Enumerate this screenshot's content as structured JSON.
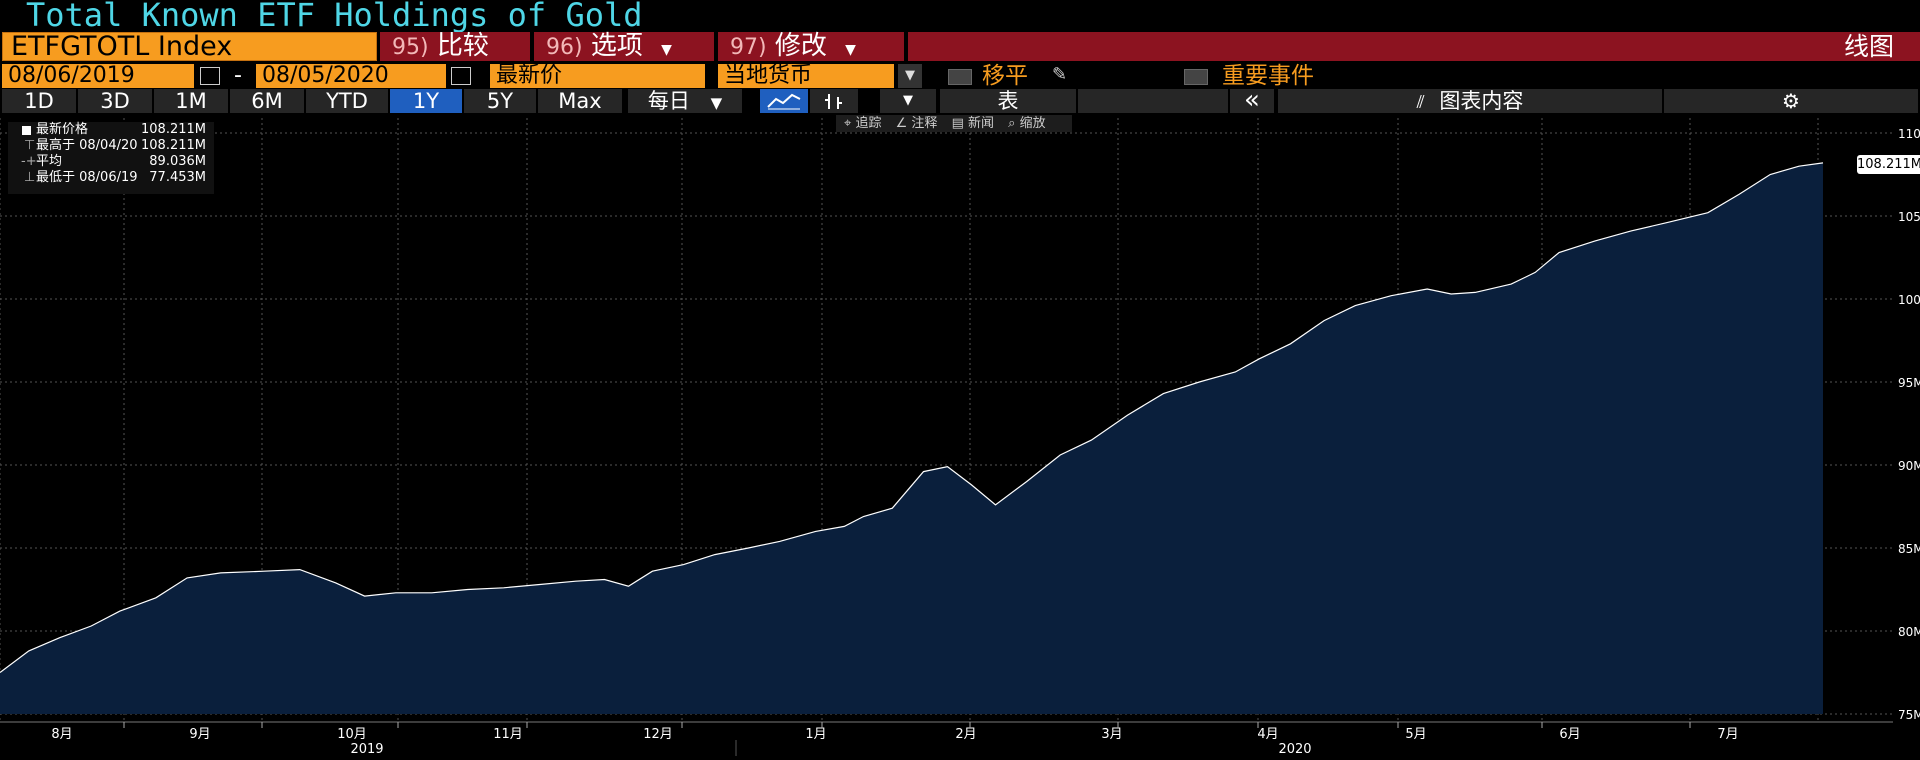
{
  "title": "Total Known ETF Holdings of Gold",
  "toolbar_row1": {
    "ticker": "ETFGTOTL Index",
    "compare": {
      "num": "95)",
      "label": "比较"
    },
    "options": {
      "num": "96)",
      "label": "选项"
    },
    "modify": {
      "num": "97)",
      "label": "修改"
    },
    "chart_type": "线图"
  },
  "toolbar_row2": {
    "start_date": "08/06/2019",
    "dash": "-",
    "end_date": "08/05/2020",
    "field": "最新价",
    "currency": "当地货币",
    "moving_avg": "移平",
    "events": "重要事件"
  },
  "toolbar_row3": {
    "ranges": [
      "1D",
      "3D",
      "1M",
      "6M",
      "YTD",
      "1Y",
      "5Y",
      "Max"
    ],
    "selected_range": "1Y",
    "frequency": "每日",
    "table": "表",
    "collapse": "«",
    "chart_content": "图表内容"
  },
  "chart_tools": {
    "track": "追踪",
    "annotate": "注释",
    "news": "新闻",
    "zoom": "缩放"
  },
  "legend": {
    "last_label": "最新价格",
    "last_value": "108.211M",
    "high_label": "最高于 08/04/20",
    "high_value": "108.211M",
    "avg_label": "平均",
    "avg_value": "89.036M",
    "low_label": "最低于 08/06/19",
    "low_value": "77.453M"
  },
  "last_value_tag": "108.211M",
  "colors": {
    "accent_orange": "#f79c1f",
    "title_cyan": "#4fd6e6",
    "header_red": "#8c1320",
    "selected_blue": "#1f5fbf",
    "area_fill": "#0a1f3c",
    "line": "#ffffff"
  },
  "chart_data": {
    "type": "area",
    "x_labels": [
      "8月",
      "9月",
      "10月",
      "11月",
      "12月",
      "1月",
      "2月",
      "3月",
      "4月",
      "5月",
      "6月",
      "7月"
    ],
    "year_labels": [
      "2019",
      "2020"
    ],
    "y_ticks": [
      "75M",
      "80M",
      "85M",
      "90M",
      "95M",
      "100M",
      "105M",
      "110M"
    ],
    "ylim": [
      75,
      110
    ],
    "y_unit": "M",
    "grid": true,
    "series": [
      {
        "values": [
          [
            0,
            77.5
          ],
          [
            12,
            78.8
          ],
          [
            25,
            79.6
          ],
          [
            38,
            80.3
          ],
          [
            50,
            81.2
          ],
          [
            65,
            82.0
          ],
          [
            78,
            83.2
          ],
          [
            92,
            83.5
          ],
          [
            110,
            83.6
          ],
          [
            125,
            83.7
          ],
          [
            140,
            82.9
          ],
          [
            152,
            82.1
          ],
          [
            165,
            82.3
          ],
          [
            180,
            82.3
          ],
          [
            195,
            82.5
          ],
          [
            210,
            82.6
          ],
          [
            225,
            82.8
          ],
          [
            240,
            83.0
          ],
          [
            252,
            83.1
          ],
          [
            262,
            82.7
          ],
          [
            272,
            83.6
          ],
          [
            285,
            84.0
          ],
          [
            298,
            84.6
          ],
          [
            312,
            85.0
          ],
          [
            325,
            85.4
          ],
          [
            340,
            86.0
          ],
          [
            352,
            86.3
          ],
          [
            360,
            86.9
          ],
          [
            372,
            87.4
          ],
          [
            385,
            89.6
          ],
          [
            395,
            89.9
          ],
          [
            405,
            88.8
          ],
          [
            415,
            87.6
          ],
          [
            428,
            89.0
          ],
          [
            442,
            90.6
          ],
          [
            455,
            91.5
          ],
          [
            470,
            93.0
          ],
          [
            485,
            94.3
          ],
          [
            500,
            95.0
          ],
          [
            515,
            95.6
          ],
          [
            525,
            96.4
          ],
          [
            538,
            97.3
          ],
          [
            552,
            98.7
          ],
          [
            565,
            99.6
          ],
          [
            580,
            100.2
          ],
          [
            595,
            100.6
          ],
          [
            605,
            100.3
          ],
          [
            615,
            100.4
          ],
          [
            630,
            100.9
          ],
          [
            640,
            101.6
          ],
          [
            650,
            102.8
          ],
          [
            665,
            103.5
          ],
          [
            680,
            104.1
          ],
          [
            695,
            104.6
          ],
          [
            712,
            105.2
          ],
          [
            725,
            106.3
          ],
          [
            738,
            107.5
          ],
          [
            750,
            108.0
          ],
          [
            760,
            108.2
          ]
        ]
      }
    ]
  }
}
